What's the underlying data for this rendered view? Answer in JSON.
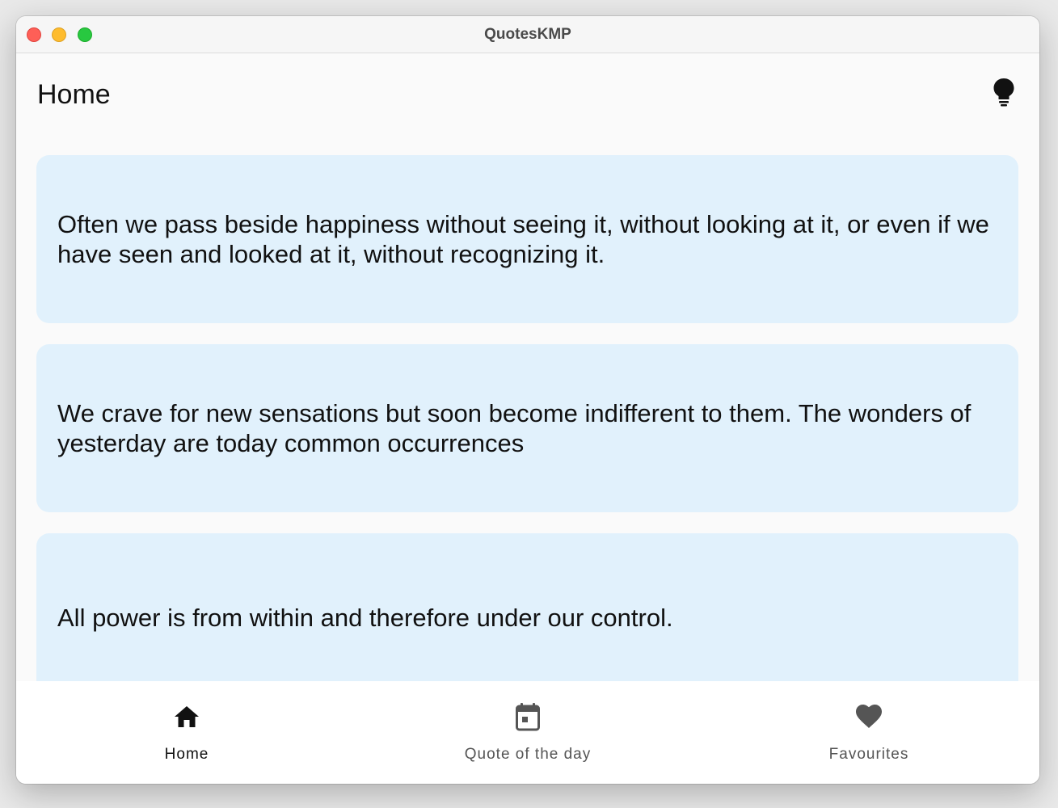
{
  "window": {
    "title": "QuotesKMP"
  },
  "appbar": {
    "title": "Home",
    "action_icon": "lightbulb-icon"
  },
  "quotes": [
    {
      "text": "Often we pass beside happiness without seeing it, without looking at it, or even if we have seen and looked at it, without recognizing it."
    },
    {
      "text": "We crave for new sensations but soon become indifferent to them. The wonders of yesterday are today common occurrences"
    },
    {
      "text": "All power is from within and therefore under our control."
    }
  ],
  "bottom_nav": {
    "items": [
      {
        "label": "Home",
        "icon": "home-icon",
        "active": true
      },
      {
        "label": "Quote of the day",
        "icon": "calendar-icon",
        "active": false
      },
      {
        "label": "Favourites",
        "icon": "heart-icon",
        "active": false
      }
    ]
  },
  "colors": {
    "card_background": "#e1f1fc",
    "page_background": "#fafafa",
    "active_nav": "#111111",
    "inactive_nav": "#555555"
  }
}
